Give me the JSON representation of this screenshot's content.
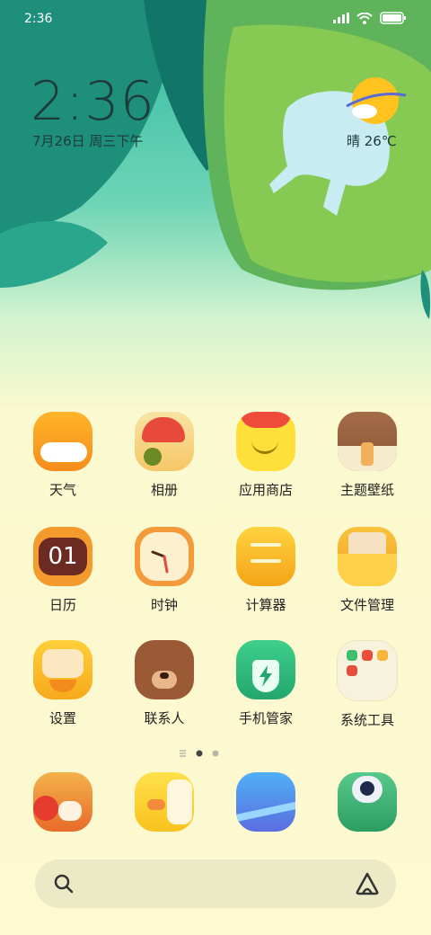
{
  "status_bar": {
    "time": "2:36"
  },
  "lockclock": {
    "time": "2:36",
    "date": "7月26日 周三下午"
  },
  "weather": {
    "text": "晴 26℃"
  },
  "apps": [
    {
      "label": "天气",
      "icon": "weather-icon"
    },
    {
      "label": "相册",
      "icon": "gallery-icon"
    },
    {
      "label": "应用商店",
      "icon": "app-store-icon"
    },
    {
      "label": "主题壁纸",
      "icon": "themes-icon"
    },
    {
      "label": "日历",
      "icon": "calendar-icon",
      "badge": "01"
    },
    {
      "label": "时钟",
      "icon": "clock-icon"
    },
    {
      "label": "计算器",
      "icon": "calculator-icon"
    },
    {
      "label": "文件管理",
      "icon": "file-manager-icon"
    },
    {
      "label": "设置",
      "icon": "settings-icon"
    },
    {
      "label": "联系人",
      "icon": "contacts-icon"
    },
    {
      "label": "手机管家",
      "icon": "security-icon"
    },
    {
      "label": "系统工具",
      "icon": "system-tools-folder-icon"
    }
  ],
  "dock": [
    {
      "icon": "phone-icon"
    },
    {
      "icon": "messages-icon"
    },
    {
      "icon": "browser-icon"
    },
    {
      "icon": "camera-icon"
    }
  ],
  "page_indicator": {
    "pages": 2,
    "current": 1
  },
  "colors": {
    "text_dark": "#1c3b3a",
    "label": "#222222",
    "search_bg": "#eceac6"
  }
}
